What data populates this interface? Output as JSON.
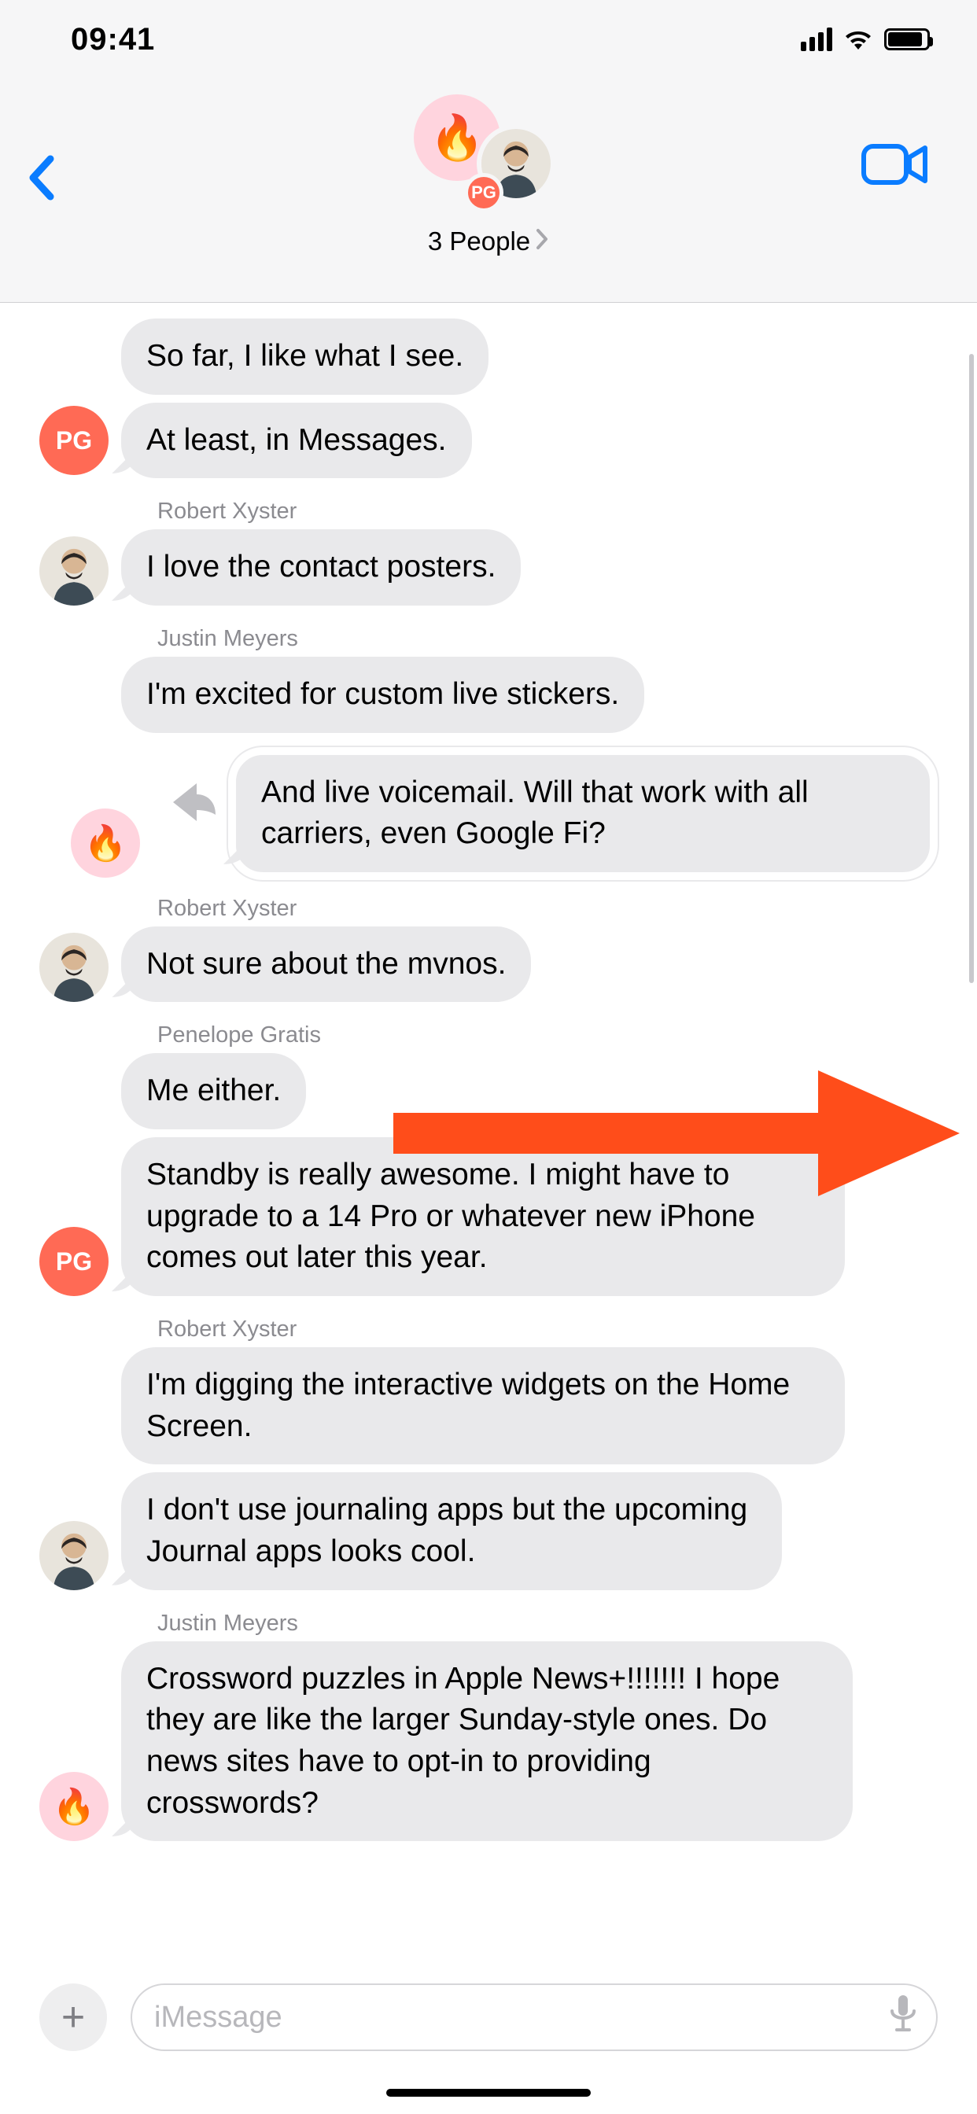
{
  "status": {
    "time": "09:41"
  },
  "header": {
    "title": "3 People",
    "stack_badge": "PG",
    "fire_emoji": "🔥"
  },
  "messages": {
    "m0": "So far, I like what I see.",
    "m1": "At least, in Messages.",
    "s1": "Robert Xyster",
    "m2": "I love the contact posters.",
    "s2": "Justin Meyers",
    "m3": "I'm excited for custom live stickers.",
    "reply": "And live voicemail. Will that work with all carriers, even Google Fi?",
    "s3": "Robert Xyster",
    "m4": "Not sure about the mvnos.",
    "s4": "Penelope Gratis",
    "m5": "Me either.",
    "m6": "Standby is really awesome. I might have to upgrade to a 14 Pro or whatever new iPhone comes out later this year.",
    "s5": "Robert Xyster",
    "m7": "I'm digging the interactive widgets on the Home Screen.",
    "m8": "I don't use journaling apps but the upcoming Journal apps looks cool.",
    "s6": "Justin Meyers",
    "m9": "Crossword puzzles in Apple News+!!!!!!! I hope they are like the larger Sunday-style ones. Do news sites have to opt-in to providing crosswords?"
  },
  "avatar": {
    "pg": "PG",
    "fire": "🔥"
  },
  "input": {
    "placeholder": "iMessage"
  }
}
